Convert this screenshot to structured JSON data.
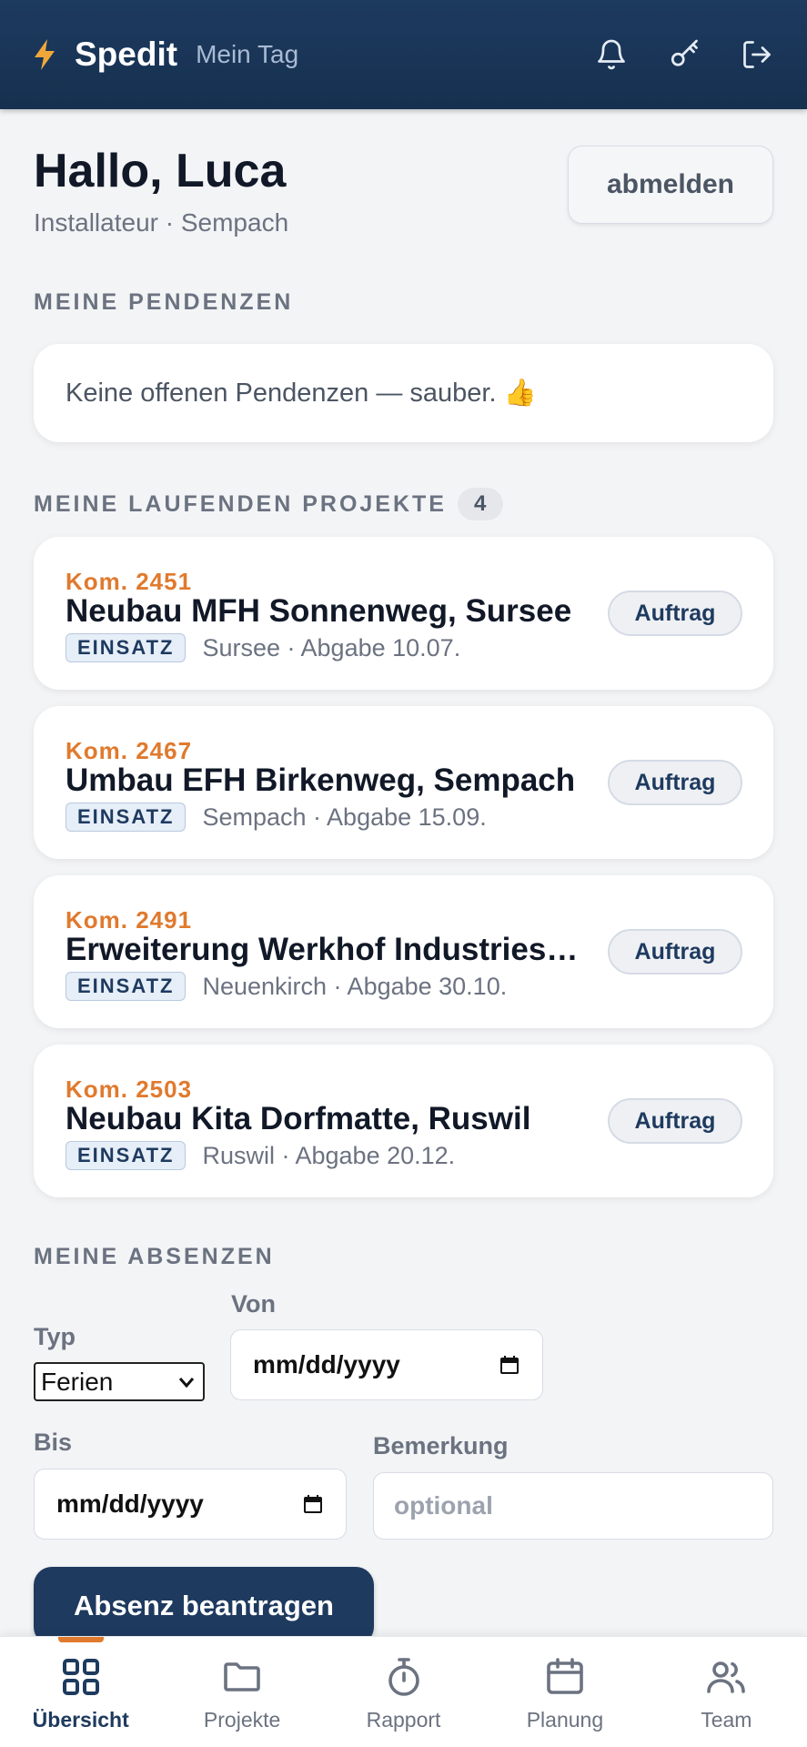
{
  "header": {
    "brand": "Spedit",
    "subtitle": "Mein Tag",
    "icons": [
      "bolt-icon",
      "bell-icon",
      "key-icon",
      "logout-icon"
    ]
  },
  "greeting": {
    "title": "Hallo, Luca",
    "subtitle": "Installateur · Sempach",
    "logout_label": "abmelden"
  },
  "pendenzen": {
    "heading": "MEINE PENDENZEN",
    "empty_text": "Keine offenen Pendenzen — sauber. 👍"
  },
  "projects": {
    "heading": "MEINE LAUFENDEN PROJEKTE",
    "count": "4",
    "items": [
      {
        "kom": "Kom. 2451",
        "title": "Neubau MFH Sonnenweg, Sursee",
        "badge": "EINSATZ",
        "meta": "Sursee · Abgabe 10.07.",
        "button": "Auftrag"
      },
      {
        "kom": "Kom. 2467",
        "title": "Umbau EFH Birkenweg, Sempach",
        "badge": "EINSATZ",
        "meta": "Sempach · Abgabe 15.09.",
        "button": "Auftrag"
      },
      {
        "kom": "Kom. 2491",
        "title": "Erweiterung Werkhof Industries…",
        "badge": "EINSATZ",
        "meta": "Neuenkirch · Abgabe 30.10.",
        "button": "Auftrag"
      },
      {
        "kom": "Kom. 2503",
        "title": "Neubau Kita Dorfmatte, Ruswil",
        "badge": "EINSATZ",
        "meta": "Ruswil · Abgabe 20.12.",
        "button": "Auftrag"
      }
    ]
  },
  "absenzen": {
    "heading": "MEINE ABSENZEN",
    "typ_label": "Typ",
    "typ_value": "Ferien",
    "von_label": "Von",
    "von_value": "mm/dd/yyyy",
    "bis_label": "Bis",
    "bis_value": "mm/dd/yyyy",
    "bemerkung_label": "Bemerkung",
    "bemerkung_placeholder": "optional",
    "submit_label": "Absenz beantragen"
  },
  "nav": {
    "items": [
      {
        "label": "Übersicht",
        "icon": "grid-icon",
        "active": true
      },
      {
        "label": "Projekte",
        "icon": "folder-icon",
        "active": false
      },
      {
        "label": "Rapport",
        "icon": "stopwatch-icon",
        "active": false
      },
      {
        "label": "Planung",
        "icon": "calendar-icon",
        "active": false
      },
      {
        "label": "Team",
        "icon": "users-icon",
        "active": false
      }
    ]
  },
  "colors": {
    "header": "#1d3a5f",
    "accent": "#e07a2e",
    "primary": "#1e3a5f"
  }
}
